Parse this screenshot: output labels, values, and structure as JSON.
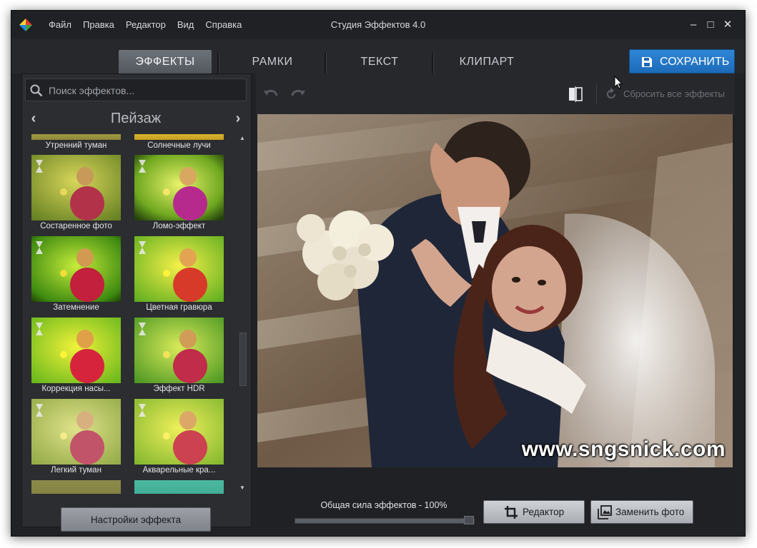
{
  "titlebar": {
    "menu": [
      "Файл",
      "Правка",
      "Редактор",
      "Вид",
      "Справка"
    ],
    "title": "Студия Эффектов 4.0",
    "controls": {
      "minimize": "–",
      "maximize": "□",
      "close": "✕"
    }
  },
  "tabs": [
    "ЭФФЕКТЫ",
    "РАМКИ",
    "ТЕКСТ",
    "КЛИПАРТ"
  ],
  "active_tab": "ЭФФЕКТЫ",
  "save_label": "СОХРАНИТЬ",
  "left": {
    "search_placeholder": "Поиск эффектов...",
    "category": "Пейзаж",
    "prev": "‹",
    "next": "›",
    "effects": [
      "Утренний туман",
      "Солнечные лучи",
      "Состаренное фото",
      "Ломо-эффект",
      "Затемнение",
      "Цветная гравюра",
      "Коррекция насы...",
      "Эффект HDR",
      "Легкий туман",
      "Акварельные кра..."
    ],
    "settings_label": "Настройки эффекта"
  },
  "toolbar": {
    "reset_label": "Сбросить все эффекты"
  },
  "photo": {
    "watermark": "www.sngsnick.com"
  },
  "bottom": {
    "strength_label": "Общая сила эффектов - 100%",
    "strength_value": 100,
    "editor_label": "Редактор",
    "replace_label": "Заменить фото"
  },
  "colors": {
    "accent": "#1f72c4",
    "background": "#202226"
  }
}
